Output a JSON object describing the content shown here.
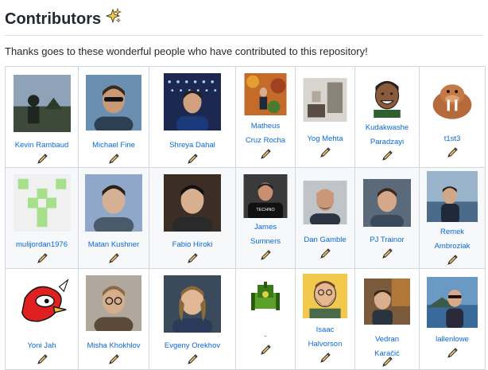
{
  "heading": {
    "text": "Contributors",
    "emoji": "sparkles-icon"
  },
  "intro": "Thanks goes to these wonderful people who have contributed to this repository!",
  "contributors": [
    [
      {
        "name": "Kevin Rambaud",
        "avatar": "silhouette-landscape"
      },
      {
        "name": "Michael Fine",
        "avatar": "man-sunglasses"
      },
      {
        "name": "Shreya Dahal",
        "avatar": "man-lights"
      },
      {
        "name": "Matheus Cruz Rocha",
        "avatar": "autumn-person"
      },
      {
        "name": "Yog Mehta",
        "avatar": "room-photo"
      },
      {
        "name": "Kudakwashe Paradzayi",
        "avatar": "cartoon-man"
      },
      {
        "name": "t1st3",
        "avatar": "cartoon-walrus"
      }
    ],
    [
      {
        "name": "mulijordan1976",
        "avatar": "identicon-green"
      },
      {
        "name": "Matan Kushner",
        "avatar": "young-man-blue"
      },
      {
        "name": "Fabio Hiroki",
        "avatar": "man-dark-hair"
      },
      {
        "name": "James Sumners",
        "avatar": "man-techno-shirt"
      },
      {
        "name": "Dan Gamble",
        "avatar": "bald-man"
      },
      {
        "name": "PJ Trainor",
        "avatar": "man-smiling"
      },
      {
        "name": "Remek Ambroziak",
        "avatar": "man-coast"
      }
    ],
    [
      {
        "name": "Yoni Jah",
        "avatar": "red-cartoon-bird"
      },
      {
        "name": "Misha Khokhlov",
        "avatar": "man-glasses"
      },
      {
        "name": "Evgeny Orekhov",
        "avatar": "young-man-long-hair"
      },
      {
        "name": "-",
        "avatar": "green-tank"
      },
      {
        "name": "Isaac Halvorson",
        "avatar": "cartoon-bearded-man"
      },
      {
        "name": "Vedran Karačić",
        "avatar": "man-blurred"
      },
      {
        "name": "lallenlowe",
        "avatar": "man-lake"
      }
    ]
  ],
  "contribution_icon": "pencil-icon"
}
